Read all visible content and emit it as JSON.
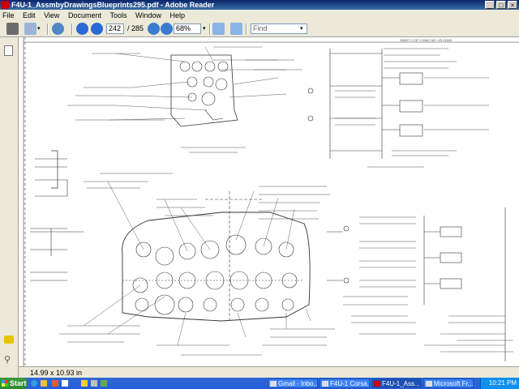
{
  "window": {
    "title": "F4U-1_AssmbyDrawingsBlueprints295.pdf - Adobe Reader",
    "min": "_",
    "max": "□",
    "close": "×"
  },
  "menu": [
    "File",
    "Edit",
    "View",
    "Document",
    "Tools",
    "Window",
    "Help"
  ],
  "toolbar": {
    "current_page": "242",
    "page_total": "/ 285",
    "zoom": "68%",
    "find_placeholder": "Find"
  },
  "status": {
    "page_size": "14.99 x 10.93 in"
  },
  "taskbar": {
    "start": "Start",
    "tasks": [
      "Gmail - Inbo...",
      "F4U-1 Corsa...",
      "F4U-1_Ass...",
      "Microsoft Fr..."
    ],
    "clock": "10:21 PM"
  },
  "doc": {
    "header_note": "SHEET 2 OF 2  DWG NO.  VS-11500"
  }
}
